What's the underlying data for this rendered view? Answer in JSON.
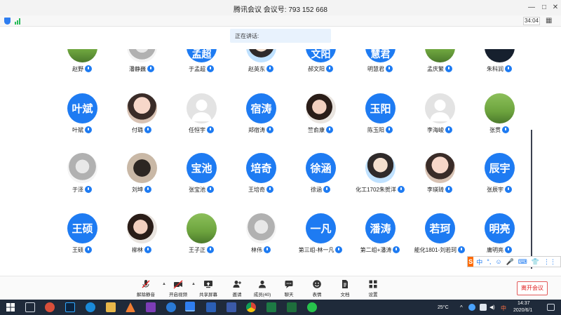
{
  "window": {
    "title": "腾讯会议 会议号: 793 152 668",
    "minimize_glyph": "—",
    "maximize_glyph": "□",
    "close_glyph": "✕"
  },
  "status": {
    "timer": "34:04"
  },
  "speaking": {
    "label": "正在讲话:"
  },
  "top_partial_row": [
    {
      "name": "赵野",
      "avatar": "photo"
    },
    {
      "name": "潘静巍",
      "avatar": "photo"
    },
    {
      "name": "于孟超",
      "avatar": "text",
      "avatar_text": "孟超"
    },
    {
      "name": "赵英东",
      "avatar": "photo"
    },
    {
      "name": "郝文阳",
      "avatar": "text",
      "avatar_text": "文阳"
    },
    {
      "name": "明慧君",
      "avatar": "text",
      "avatar_text": "慧君"
    },
    {
      "name": "孟庆繁",
      "avatar": "photo"
    },
    {
      "name": "朱科润",
      "avatar": "photo"
    }
  ],
  "rows": [
    [
      {
        "name": "叶斌",
        "avatar": "text",
        "avatar_text": "叶斌"
      },
      {
        "name": "付璐",
        "avatar": "photo"
      },
      {
        "name": "任恒宇",
        "avatar": "default"
      },
      {
        "name": "郑宿涛",
        "avatar": "text",
        "avatar_text": "宿涛"
      },
      {
        "name": "竺俞康",
        "avatar": "photo"
      },
      {
        "name": "陈玉阳",
        "avatar": "text",
        "avatar_text": "玉阳"
      },
      {
        "name": "李海峻",
        "avatar": "default"
      },
      {
        "name": "张贯",
        "avatar": "photo"
      }
    ],
    [
      {
        "name": "于泽",
        "avatar": "photo"
      },
      {
        "name": "刘坤",
        "avatar": "photo"
      },
      {
        "name": "张宝池",
        "avatar": "text",
        "avatar_text": "宝池"
      },
      {
        "name": "王培奇",
        "avatar": "text",
        "avatar_text": "培奇"
      },
      {
        "name": "徐涵",
        "avatar": "text",
        "avatar_text": "徐涵"
      },
      {
        "name": "化工1702朱贺洋",
        "avatar": "photo"
      },
      {
        "name": "李瑛琦",
        "avatar": "photo"
      },
      {
        "name": "张辰宇",
        "avatar": "text",
        "avatar_text": "辰宇"
      }
    ],
    [
      {
        "name": "王硕",
        "avatar": "text",
        "avatar_text": "王硕"
      },
      {
        "name": "柳林",
        "avatar": "photo"
      },
      {
        "name": "王子正",
        "avatar": "photo"
      },
      {
        "name": "林伟",
        "avatar": "photo"
      },
      {
        "name": "第三组-林一凡",
        "avatar": "text",
        "avatar_text": "一凡"
      },
      {
        "name": "第二组+潘涛",
        "avatar": "text",
        "avatar_text": "潘涛"
      },
      {
        "name": "能化1801-刘若珂",
        "avatar": "text",
        "avatar_text": "若珂"
      },
      {
        "name": "庸明亮",
        "avatar": "text",
        "avatar_text": "明亮"
      }
    ]
  ],
  "ime": {
    "brand": "S",
    "items": [
      "中",
      "°,",
      "☺",
      "🎤",
      "⌨",
      "👕",
      "⋮⋮"
    ]
  },
  "toolbar": {
    "mute_all": "解除静音",
    "video": "开启视频",
    "share": "共享屏幕",
    "invite": "邀请",
    "members": "成员(40)",
    "chat": "聊天",
    "emoji": "表情",
    "docs": "文档",
    "settings": "设置",
    "leave": "离开会议"
  },
  "taskbar": {
    "temperature": "25°C",
    "time": "14:37",
    "date": "2020/6/1",
    "lang": "中"
  },
  "colors": {
    "accent": "#1e7bf2",
    "leave": "#e02020"
  }
}
